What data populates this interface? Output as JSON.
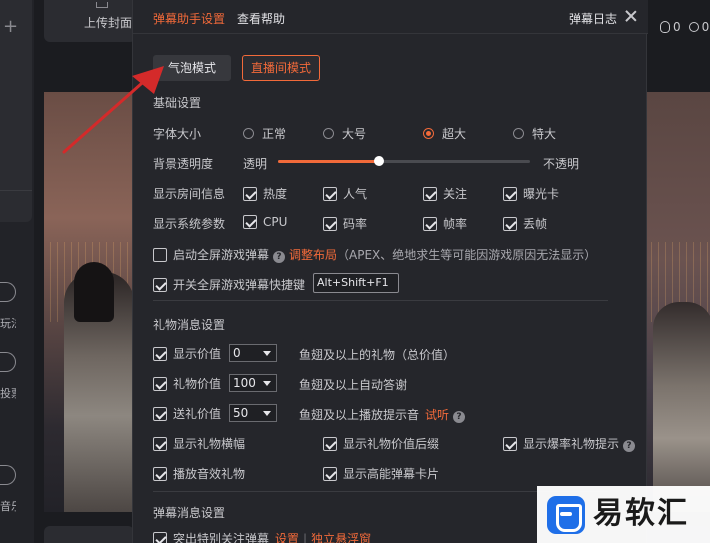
{
  "background": {
    "upload_label": "上传封面",
    "left_labels": [
      "玩法",
      "投票",
      "音乐"
    ],
    "like_count": "0",
    "view_count": "0"
  },
  "dialog": {
    "tabs": {
      "settings": "弹幕助手设置",
      "help": "查看帮助"
    },
    "log_label": "弹幕日志",
    "modes": {
      "bubble": "气泡模式",
      "room": "直播间模式"
    },
    "basic": {
      "title": "基础设置",
      "font_size": {
        "label": "字体大小",
        "options": [
          "正常",
          "大号",
          "超大",
          "特大"
        ],
        "selected": "超大"
      },
      "opacity": {
        "label": "背景透明度",
        "min_label": "透明",
        "max_label": "不透明",
        "value_percent": 40
      },
      "room_info": {
        "label": "显示房间信息",
        "items": [
          {
            "label": "热度",
            "checked": true
          },
          {
            "label": "人气",
            "checked": true
          },
          {
            "label": "关注",
            "checked": true
          },
          {
            "label": "曝光卡",
            "checked": true
          }
        ]
      },
      "sys_params": {
        "label": "显示系统参数",
        "items": [
          {
            "label": "CPU",
            "checked": true
          },
          {
            "label": "码率",
            "checked": true
          },
          {
            "label": "帧率",
            "checked": true
          },
          {
            "label": "丢帧",
            "checked": true
          }
        ]
      },
      "fullscreen_game": {
        "label": "启动全屏游戏弹幕",
        "checked": false,
        "help": "?",
        "adjust_link": "调整布局",
        "hint": "（APEX、绝地求生等可能因游戏原因无法显示）"
      },
      "shortcut": {
        "label": "开关全屏游戏弹幕快捷键",
        "checked": true,
        "value": "Alt+Shift+F1"
      }
    },
    "gift": {
      "title": "礼物消息设置",
      "show_value": {
        "label": "显示价值",
        "checked": true,
        "value": "0",
        "suffix": "鱼翅及以上的礼物（总价值）"
      },
      "gift_value": {
        "label": "礼物价值",
        "checked": true,
        "value": "100",
        "suffix": "鱼翅及以上自动答谢"
      },
      "send_value": {
        "label": "送礼价值",
        "checked": true,
        "value": "50",
        "suffix": "鱼翅及以上播放提示音",
        "link": "试听",
        "help": "?"
      },
      "banner": {
        "label": "显示礼物横幅",
        "checked": true
      },
      "price_suffix": {
        "label": "显示礼物价值后缀",
        "checked": true
      },
      "burst_tip": {
        "label": "显示爆率礼物提示",
        "checked": true,
        "help": "?"
      },
      "sound_gift": {
        "label": "播放音效礼物",
        "checked": true
      },
      "high_energy": {
        "label": "显示高能弹幕卡片",
        "checked": true
      }
    },
    "danmu": {
      "title": "弹幕消息设置",
      "highlight": {
        "label": "突出特别关注弹幕",
        "checked": true,
        "settings_link": "设置",
        "float_link": "独立悬浮窗"
      }
    }
  },
  "watermark": {
    "text": "易软汇"
  },
  "colors": {
    "accent": "#f26a3a",
    "panel": "#25262b",
    "arrow": "#d42a2a"
  }
}
